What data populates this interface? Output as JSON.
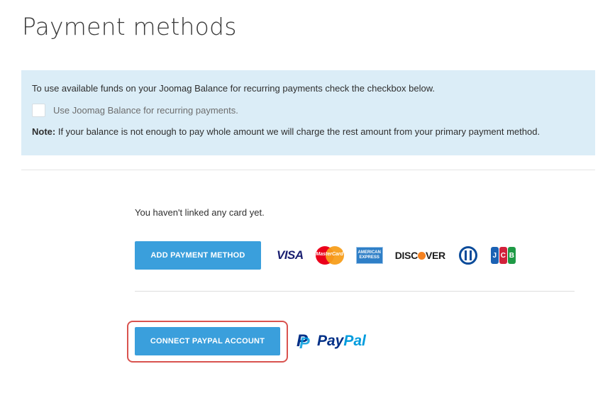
{
  "page": {
    "title": "Payment methods"
  },
  "balance_box": {
    "intro": "To use available funds on your Joomag Balance for recurring payments check the checkbox below.",
    "checkbox_label": "Use Joomag Balance for recurring payments.",
    "checkbox_checked": false,
    "note_label": "Note:",
    "note_text": " If your balance is not enough to pay whole amount we will charge the rest amount from your primary payment method."
  },
  "cards_section": {
    "empty_message": "You haven't linked any card yet.",
    "add_button_label": "ADD PAYMENT METHOD",
    "card_logos": [
      {
        "icon": "visa-icon",
        "text": "VISA"
      },
      {
        "icon": "mastercard-icon",
        "text": "MasterCard"
      },
      {
        "icon": "amex-icon",
        "text_line1": "AMERICAN",
        "text_line2": "EXPRESS"
      },
      {
        "icon": "discover-icon",
        "text_before": "DISC",
        "text_after": "VER"
      },
      {
        "icon": "diners-club-icon"
      },
      {
        "icon": "jcb-icon",
        "letters": [
          "J",
          "C",
          "B"
        ]
      }
    ]
  },
  "paypal_section": {
    "connect_button_label": "CONNECT PAYPAL ACCOUNT",
    "logo_icon": "paypal-icon",
    "logo_icon_letter": "P",
    "logo_text_pay": "Pay",
    "logo_text_pal": "Pal"
  },
  "colors": {
    "button_bg": "#3a9fdc",
    "info_box_bg": "#dbedf7",
    "highlight_border": "#d9534f"
  }
}
